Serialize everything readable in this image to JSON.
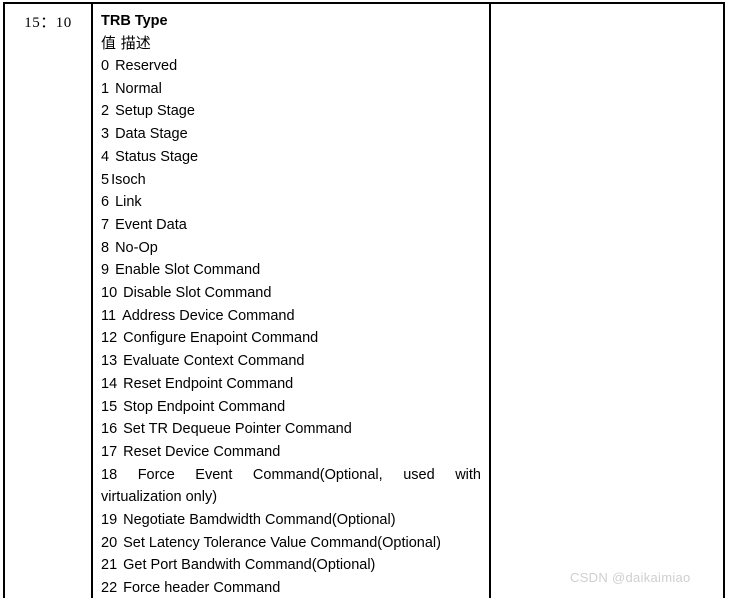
{
  "table": {
    "bit_range": "15：10",
    "title": "TRB Type",
    "column_header": "值  描述",
    "types": [
      {
        "value": "0",
        "name": "Reserved"
      },
      {
        "value": "1",
        "name": "Normal"
      },
      {
        "value": "2",
        "name": "Setup Stage"
      },
      {
        "value": "3",
        "name": "Data Stage"
      },
      {
        "value": "4",
        "name": "Status Stage"
      },
      {
        "value": "5",
        "name": "Isoch"
      },
      {
        "value": "6",
        "name": "Link"
      },
      {
        "value": "7",
        "name": "Event Data"
      },
      {
        "value": "8",
        "name": "No-Op"
      },
      {
        "value": "9",
        "name": "Enable Slot Command"
      },
      {
        "value": "10",
        "name": "Disable Slot Command"
      },
      {
        "value": "11",
        "name": "Address Device Command"
      },
      {
        "value": "12",
        "name": "Configure Enapoint Command"
      },
      {
        "value": "13",
        "name": "Evaluate Context Command"
      },
      {
        "value": "14",
        "name": "Reset Endpoint Command"
      },
      {
        "value": "15",
        "name": "Stop Endpoint Command"
      },
      {
        "value": "16",
        "name": "Set TR Dequeue Pointer Command"
      },
      {
        "value": "17",
        "name": "Reset Device Command"
      },
      {
        "value": "18",
        "name": "Force Event Command(Optional, used with virtualization only)"
      },
      {
        "value": "19",
        "name": "Negotiate Bamdwidth Command(Optional)"
      },
      {
        "value": "20",
        "name": "Set Latency Tolerance Value Command(Optional)"
      },
      {
        "value": "21",
        "name": "Get Port Bandwith Command(Optional)"
      },
      {
        "value": "22",
        "name": "Force header Command"
      }
    ]
  },
  "watermark": "CSDN @daikaimiao"
}
